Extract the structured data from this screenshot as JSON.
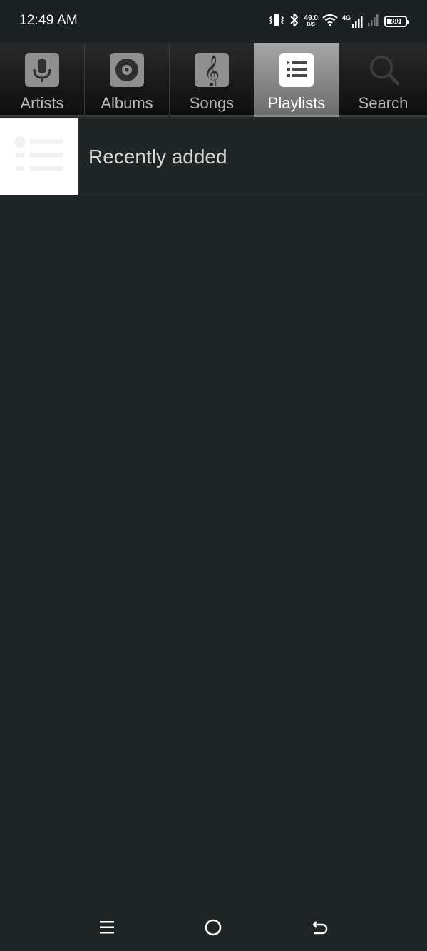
{
  "status_bar": {
    "time": "12:49 AM",
    "net_speed_value": "49.0",
    "net_speed_unit": "B/S",
    "network_type": "4G",
    "battery_level": "80",
    "battery_fraction": 0.8,
    "icons": [
      "vibrate-icon",
      "bluetooth-icon",
      "wifi-icon",
      "signal-icon",
      "signal-icon-2",
      "battery-icon"
    ]
  },
  "tabs": [
    {
      "label": "Artists",
      "icon": "microphone-icon",
      "active": false
    },
    {
      "label": "Albums",
      "icon": "disc-icon",
      "active": false
    },
    {
      "label": "Songs",
      "icon": "treble-clef-icon",
      "active": false
    },
    {
      "label": "Playlists",
      "icon": "playlist-icon",
      "active": true
    },
    {
      "label": "Search",
      "icon": "search-icon",
      "active": false
    }
  ],
  "playlists": [
    {
      "label": "Recently added"
    }
  ],
  "nav_bar": {
    "icons": [
      "menu-icon",
      "home-icon",
      "back-icon"
    ]
  },
  "colors": {
    "background": "#202526",
    "status_bar": "#1b2022",
    "active_tab": "#a6a6a6",
    "text": "#d6d8d8"
  }
}
